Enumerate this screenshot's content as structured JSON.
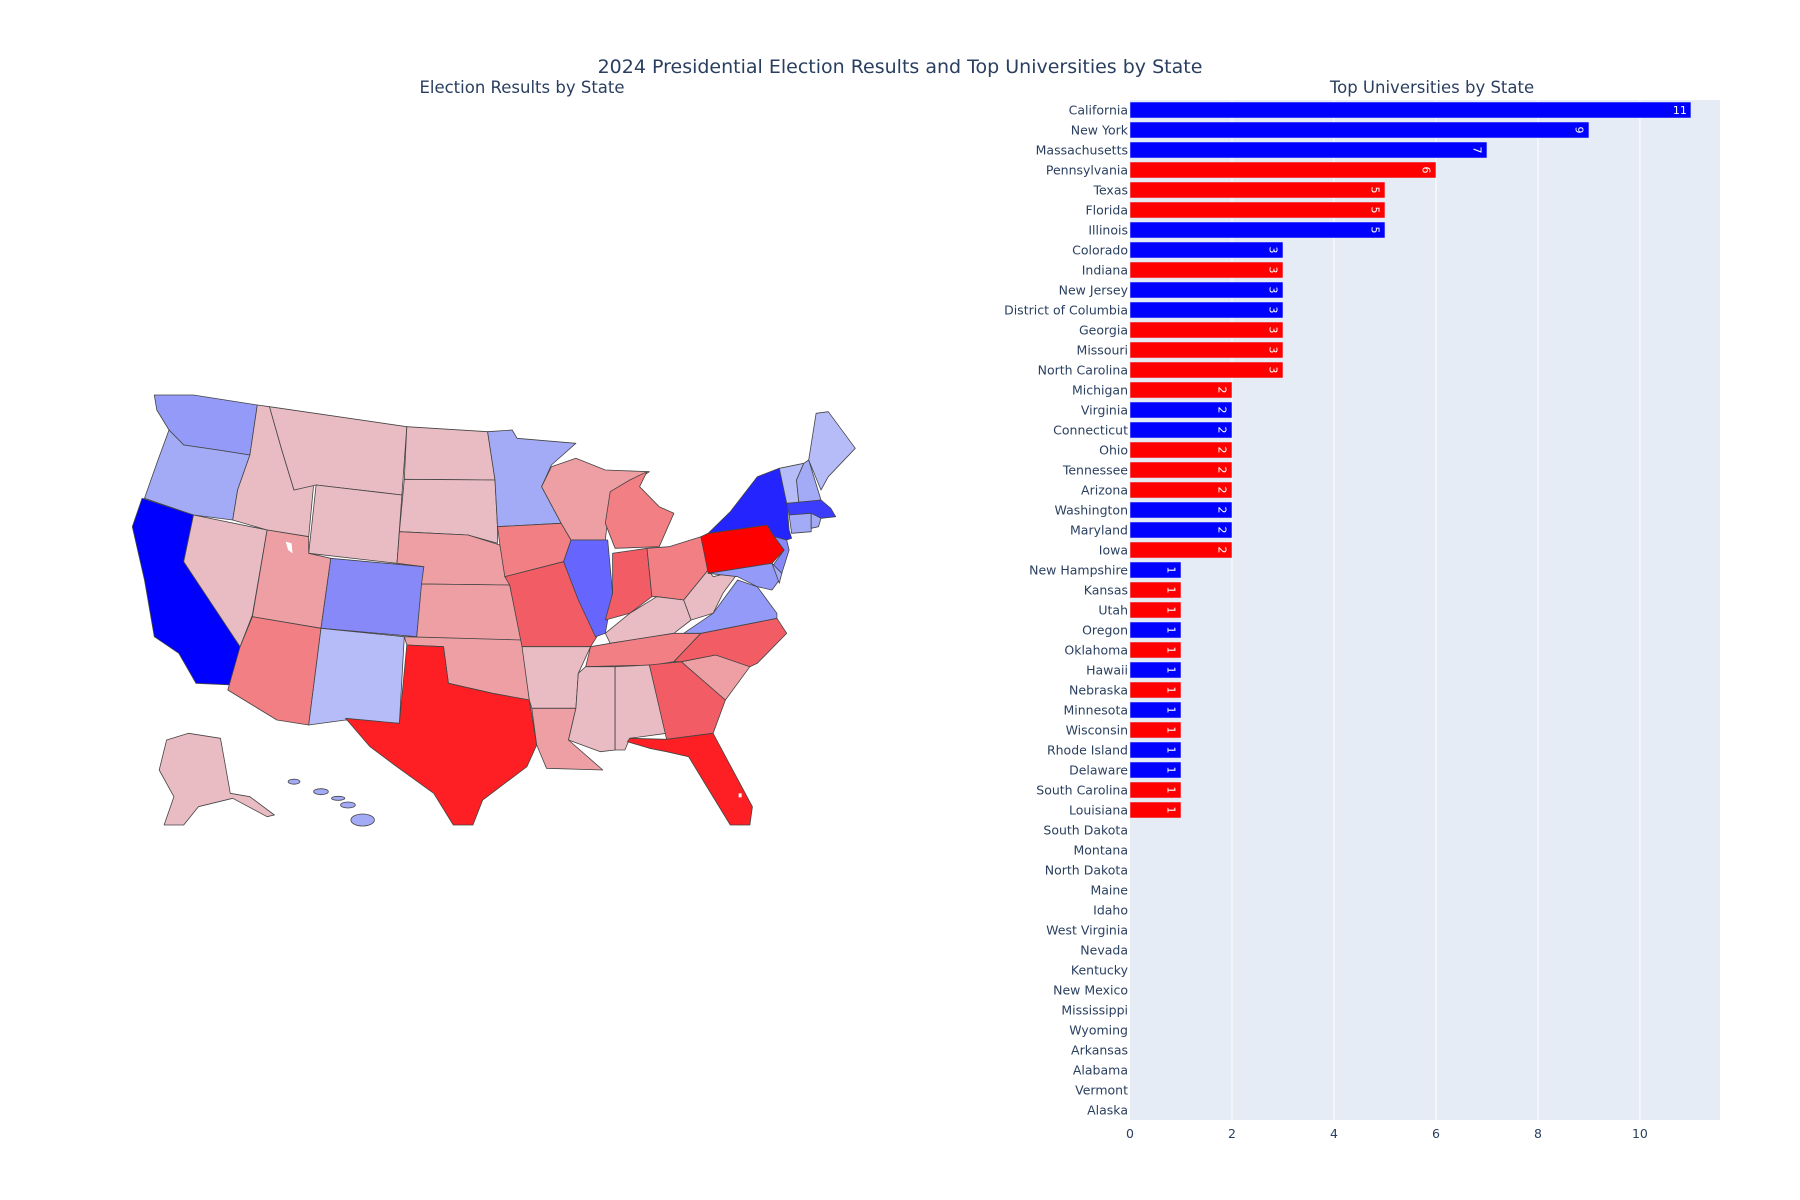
{
  "title": "2024 Presidential Election Results and Top Universities by State",
  "map": {
    "title": "Election Results by State",
    "state_colors": {
      "WA": "#939af7",
      "OR": "#a3aaf6",
      "CA": "#0000ff",
      "NV": "#e9bcc3",
      "ID": "#e9bcc3",
      "MT": "#e9bcc3",
      "WY": "#e9bcc3",
      "UT": "#ee9fa3",
      "CO": "#8789f9",
      "AZ": "#f17f84",
      "NM": "#b6bcf8",
      "ND": "#e9bcc3",
      "SD": "#e9bcc3",
      "NE": "#ee9fa3",
      "KS": "#ee9fa3",
      "OK": "#ee9fa3",
      "TX": "#fd1f23",
      "MN": "#a3aaf6",
      "IA": "#f17f84",
      "MO": "#f25d65",
      "AR": "#e9bcc3",
      "LA": "#ee9fa3",
      "WI": "#ee9fa3",
      "IL": "#6666ff",
      "MI": "#f17f84",
      "IN": "#f25d65",
      "OH": "#f17f84",
      "KY": "#e9bcc3",
      "TN": "#f17f84",
      "MS": "#e9bcc3",
      "AL": "#e9bcc3",
      "GA": "#f25d65",
      "FL": "#fd1f23",
      "SC": "#ee9fa3",
      "NC": "#f25d65",
      "VA": "#939af7",
      "WV": "#e9bcc3",
      "PA": "#ff0000",
      "NY": "#2424ff",
      "NJ": "#8789f9",
      "MD": "#939af7",
      "DE": "#a3aaf6",
      "VT": "#b6bcf8",
      "NH": "#a3aaf6",
      "ME": "#b6bcf8",
      "MA": "#3c3cff",
      "CT": "#a3aaf6",
      "RI": "#a3aaf6",
      "AK": "#e9bcc3",
      "HI": "#a3aaf6"
    }
  },
  "chart_data": {
    "type": "bar",
    "orientation": "horizontal",
    "title": "Top Universities by State",
    "xlabel": "",
    "ylabel": "",
    "xlim": [
      0,
      11.57
    ],
    "xticks": [
      0,
      2,
      4,
      6,
      8,
      10
    ],
    "grid": true,
    "party_colors": {
      "Democrat": "#0000ff",
      "Republican": "#ff0000"
    },
    "categories": [
      "California",
      "New York",
      "Massachusetts",
      "Pennsylvania",
      "Texas",
      "Florida",
      "Illinois",
      "Colorado",
      "Indiana",
      "New Jersey",
      "District of Columbia",
      "Georgia",
      "Missouri",
      "North Carolina",
      "Michigan",
      "Virginia",
      "Connecticut",
      "Ohio",
      "Tennessee",
      "Arizona",
      "Washington",
      "Maryland",
      "Iowa",
      "New Hampshire",
      "Kansas",
      "Utah",
      "Oregon",
      "Oklahoma",
      "Hawaii",
      "Nebraska",
      "Minnesota",
      "Wisconsin",
      "Rhode Island",
      "Delaware",
      "South Carolina",
      "Louisiana",
      "South Dakota",
      "Montana",
      "North Dakota",
      "Maine",
      "Idaho",
      "West Virginia",
      "Nevada",
      "Kentucky",
      "New Mexico",
      "Mississippi",
      "Wyoming",
      "Arkansas",
      "Alabama",
      "Vermont",
      "Alaska"
    ],
    "values": [
      11,
      9,
      7,
      6,
      5,
      5,
      5,
      3,
      3,
      3,
      3,
      3,
      3,
      3,
      2,
      2,
      2,
      2,
      2,
      2,
      2,
      2,
      2,
      1,
      1,
      1,
      1,
      1,
      1,
      1,
      1,
      1,
      1,
      1,
      1,
      1,
      0,
      0,
      0,
      0,
      0,
      0,
      0,
      0,
      0,
      0,
      0,
      0,
      0,
      0,
      0
    ],
    "party": [
      "D",
      "D",
      "D",
      "R",
      "R",
      "R",
      "D",
      "D",
      "R",
      "D",
      "D",
      "R",
      "R",
      "R",
      "R",
      "D",
      "D",
      "R",
      "R",
      "R",
      "D",
      "D",
      "R",
      "D",
      "R",
      "R",
      "D",
      "R",
      "D",
      "R",
      "D",
      "R",
      "D",
      "D",
      "R",
      "R",
      "",
      "",
      "",
      "",
      "",
      "",
      "",
      "",
      "",
      "",
      "",
      "",
      "",
      "",
      ""
    ]
  }
}
